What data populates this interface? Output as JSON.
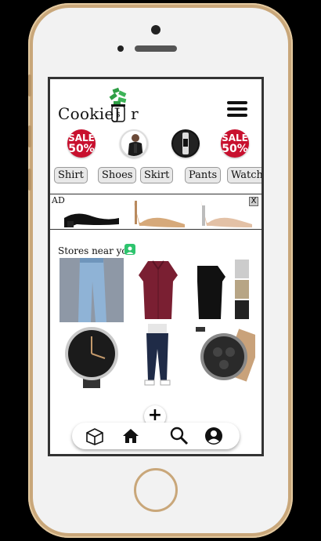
{
  "header": {
    "logo_text": "CookieJ  r",
    "menu_icon": "hamburger-icon"
  },
  "featured": [
    {
      "type": "sale",
      "line1": "SALE",
      "line2": "50%"
    },
    {
      "type": "image",
      "icon": "jacket-person-thumb"
    },
    {
      "type": "image",
      "icon": "smartwatch-thumb"
    },
    {
      "type": "sale",
      "line1": "SALE",
      "line2": "50%"
    }
  ],
  "categories": [
    "Shirt",
    "Shoes",
    "Skirt",
    "Pants",
    "Watch"
  ],
  "ad": {
    "label": "AD",
    "close": "X"
  },
  "stores": {
    "title": "Stores near you",
    "icon": "store-user-icon"
  },
  "products": [
    {
      "icon": "jeans-thumb"
    },
    {
      "icon": "shirt-thumb"
    },
    {
      "icon": "black-shirt-thumb"
    },
    {
      "icon": "watch-thumb"
    },
    {
      "icon": "jeans-man-thumb"
    },
    {
      "icon": "chronograph-thumb"
    }
  ],
  "fab": {
    "label": "+"
  },
  "nav": [
    "box-icon",
    "home-icon",
    "search-icon",
    "profile-icon"
  ],
  "colors": {
    "sale": "#c8102e",
    "phone_gold": "#c9a77a",
    "store_icon": "#2ec46e"
  }
}
